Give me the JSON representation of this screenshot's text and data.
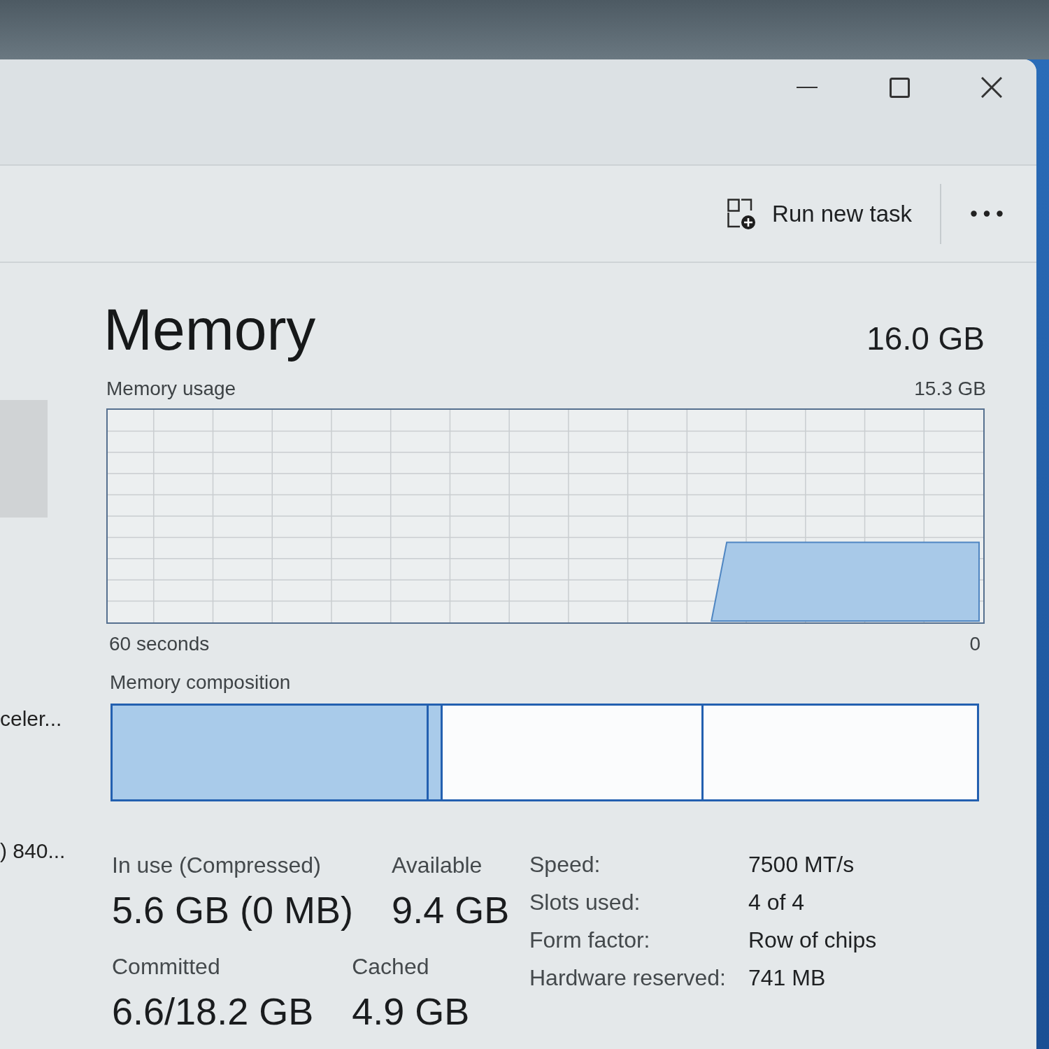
{
  "toolbar": {
    "run_new_task": {
      "label": "Run new task"
    }
  },
  "sidebar": {
    "items": [
      {
        "selected": true
      },
      {
        "label": "celer...",
        "selected": false
      },
      {
        "label": ") 840...",
        "selected": false
      }
    ]
  },
  "memory": {
    "title": "Memory",
    "total": "16.0 GB",
    "usage_graph": {
      "label": "Memory usage",
      "max": "15.3 GB",
      "x_start": "60 seconds",
      "x_end": "0"
    },
    "composition": {
      "label": "Memory composition",
      "segments": [
        {
          "kind": "in_use"
        },
        {
          "kind": "modified"
        },
        {
          "kind": "standby"
        },
        {
          "kind": "free"
        }
      ]
    },
    "stat_rows": [
      [
        {
          "label": "In use (Compressed)",
          "value": "5.6 GB (0 MB)"
        },
        {
          "label": "Available",
          "value": "9.4 GB"
        }
      ],
      [
        {
          "label": "Committed",
          "value": "6.6/18.2 GB"
        },
        {
          "label": "Cached",
          "value": "4.9 GB"
        }
      ]
    ],
    "details": [
      {
        "label": "Speed:",
        "value": "7500 MT/s"
      },
      {
        "label": "Slots used:",
        "value": "4 of 4"
      },
      {
        "label": "Form factor:",
        "value": "Row of chips"
      },
      {
        "label": "Hardware reserved:",
        "value": "741 MB"
      }
    ]
  }
}
